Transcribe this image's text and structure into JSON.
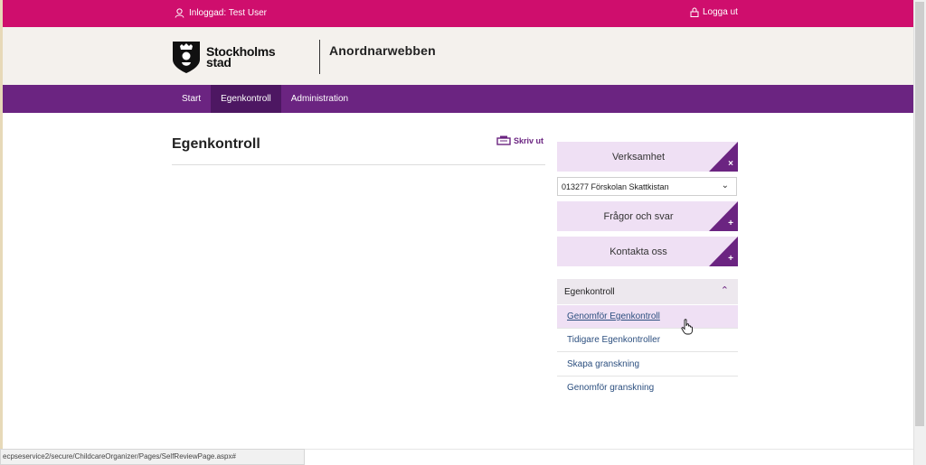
{
  "topbar": {
    "user_text": "Inloggad: Test User",
    "logout_label": "Logga ut"
  },
  "header": {
    "logo_line1": "Stockholms",
    "logo_line2": "stad",
    "app_name": "Anordnarwebben"
  },
  "nav": {
    "items": [
      {
        "label": "Start"
      },
      {
        "label": "Egenkontroll"
      },
      {
        "label": "Administration"
      }
    ],
    "active": "Egenkontroll"
  },
  "main": {
    "title": "Egenkontroll",
    "print_label": "Skriv ut"
  },
  "sidebar": {
    "verksamhet": {
      "label": "Verksamhet",
      "symbol": "×"
    },
    "select_value": "013277 Förskolan Skattkistan",
    "faq": {
      "label": "Frågor och svar",
      "symbol": "+"
    },
    "contact": {
      "label": "Kontakta oss",
      "symbol": "+"
    },
    "accordion": {
      "title": "Egenkontroll",
      "items": [
        {
          "label": "Genomför Egenkontroll"
        },
        {
          "label": "Tidigare Egenkontroller"
        },
        {
          "label": "Skapa granskning"
        },
        {
          "label": "Genomför granskning"
        }
      ]
    }
  },
  "status_url": "ecpseservice2/secure/ChildcareOrganizer/Pages/SelfReviewPage.aspx#",
  "colors": {
    "topbar": "#cf0e6d",
    "nav": "#6b2481",
    "nav_active": "#4d1762",
    "panel": "#efe0f4",
    "link": "#2c4f7f"
  }
}
